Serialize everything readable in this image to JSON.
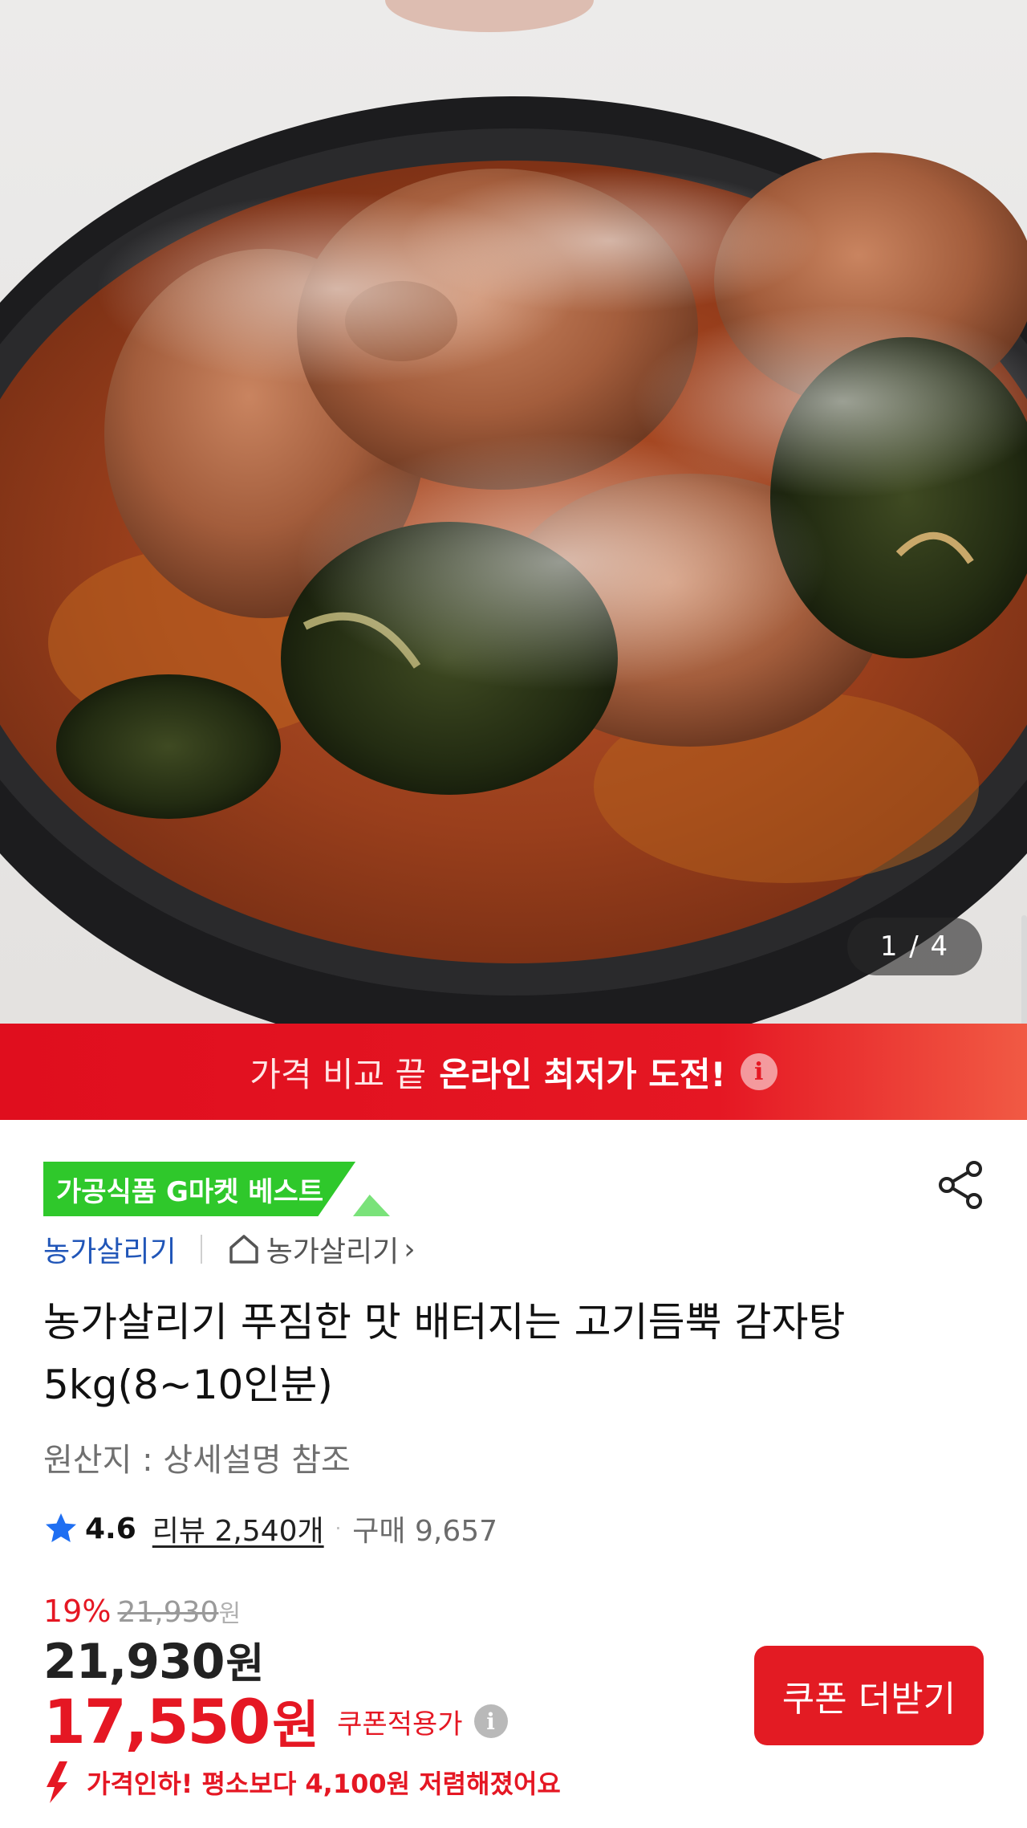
{
  "gallery": {
    "counter": "1 / 4",
    "image_subject": "gamjatang-stew-photo"
  },
  "banner": {
    "text_light": "가격 비교 끝",
    "text_bold": "온라인 최저가 도전!",
    "info_glyph": "i"
  },
  "product": {
    "badge": "가공식품 G마켓 베스트",
    "brand": "농가살리기",
    "store": "농가살리기",
    "store_chevron": "›",
    "title": "농가살리기 푸짐한 맛 배터지는 고기듬뿍 감자탕 5kg(8~10인분)",
    "origin": "원산지 : 상세설명 참조",
    "rating": "4.6",
    "reviews": "리뷰 2,540개",
    "separator": "·",
    "purchases": "구매 9,657"
  },
  "pricing": {
    "discount_percent": "19%",
    "original_price": "21,930",
    "original_unit": "원",
    "price": "21,930",
    "price_unit": "원",
    "coupon_price": "17,550",
    "coupon_unit": "원",
    "coupon_label": "쿠폰적용가",
    "coupon_info_glyph": "i",
    "coupon_button": "쿠폰 더받기",
    "price_drop_text": "가격인하! 평소보다 4,100원 저렴해졌어요"
  },
  "colors": {
    "accent_red": "#e51723",
    "badge_green": "#2fc82b",
    "link_blue": "#2156b8"
  }
}
